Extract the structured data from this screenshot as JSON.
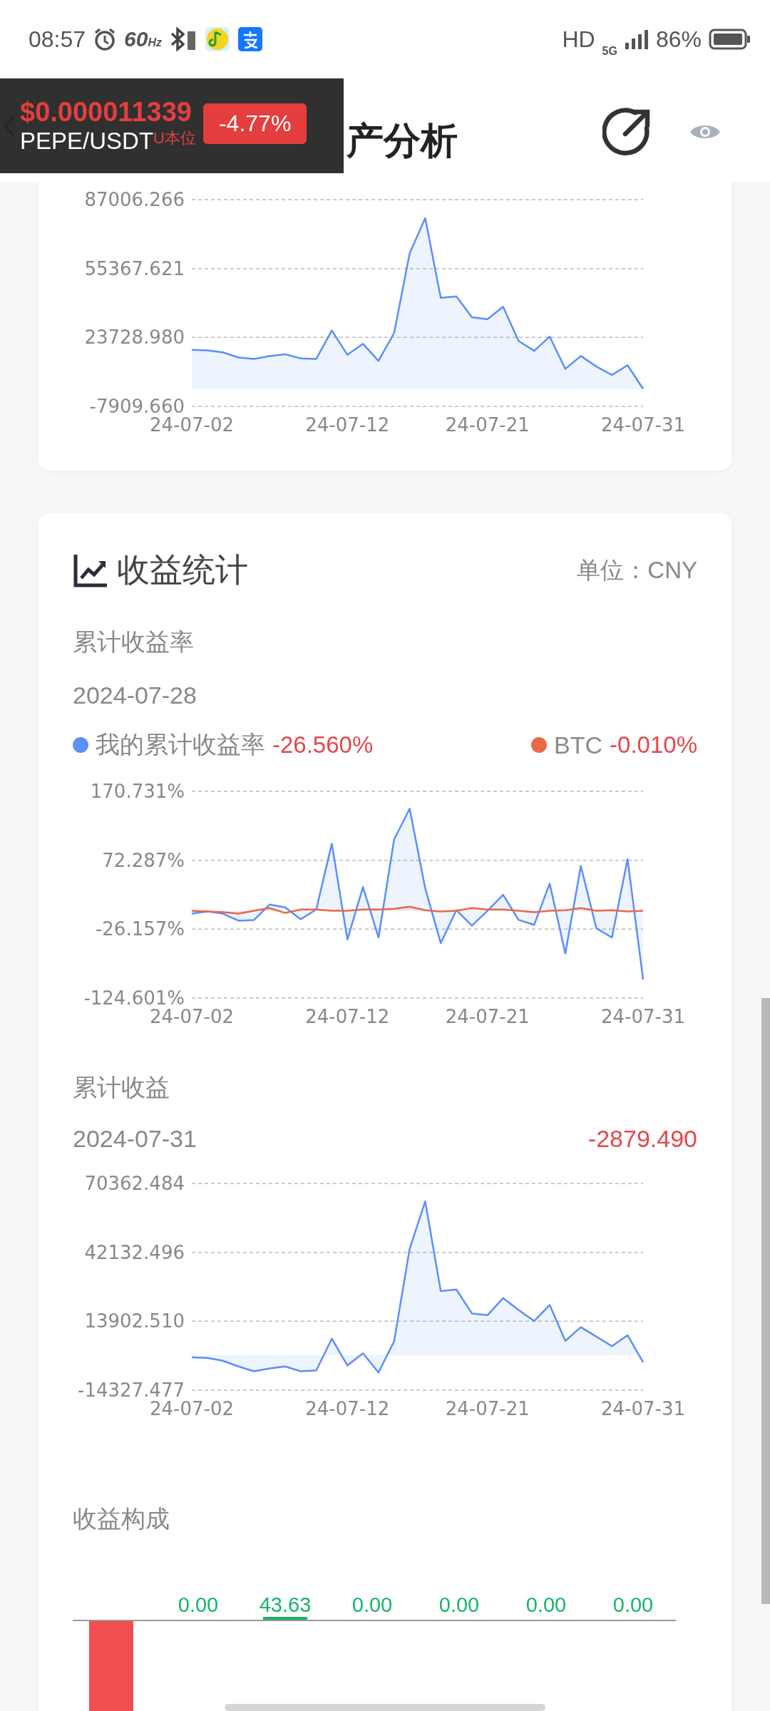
{
  "status_bar": {
    "time": "08:57",
    "refresh_rate": "60",
    "refresh_unit": "Hz",
    "network_hd": "HD",
    "network_type": "5G",
    "battery": "86%"
  },
  "ticker": {
    "price": "$0.000011339",
    "pair": "PEPE/USDT",
    "market": "U本位",
    "change": "-4.77%"
  },
  "header": {
    "title": "产分析"
  },
  "asset_chart": {
    "chart_data": {
      "type": "area",
      "categories": [
        "24-07-02",
        null,
        null,
        null,
        null,
        null,
        null,
        null,
        null,
        null,
        "24-07-12",
        null,
        null,
        null,
        null,
        null,
        null,
        null,
        null,
        "24-07-21",
        null,
        null,
        null,
        null,
        null,
        null,
        null,
        null,
        null,
        "24-07-31"
      ],
      "series": [
        {
          "color": "#5b8ff9",
          "values": [
            18000,
            17800,
            16900,
            14500,
            13900,
            15200,
            16000,
            14100,
            13900,
            26900,
            15800,
            20800,
            13000,
            25800,
            62400,
            78500,
            41900,
            42600,
            33000,
            32100,
            37800,
            22100,
            17600,
            24100,
            9300,
            15200,
            10400,
            6500,
            11000,
            100
          ]
        }
      ],
      "ylim": [
        -7909.66,
        87006.266
      ],
      "yticks": [
        {
          "value": 87006.266,
          "label": "87006.266"
        },
        {
          "value": 55367.621,
          "label": "55367.621"
        },
        {
          "value": 23728.98,
          "label": "23728.980"
        },
        {
          "value": -7909.66,
          "label": "-7909.660"
        }
      ]
    }
  },
  "profit_stats": {
    "title": "收益统计",
    "unit": "单位：CNY",
    "rate": {
      "title": "累计收益率",
      "date": "2024-07-28",
      "readings": [
        "-26.560%",
        "-0.010%"
      ],
      "chart_data": {
        "type": "area",
        "categories": [
          "24-07-02",
          null,
          null,
          null,
          null,
          null,
          null,
          null,
          null,
          null,
          "24-07-12",
          null,
          null,
          null,
          null,
          null,
          null,
          null,
          null,
          "24-07-21",
          null,
          null,
          null,
          null,
          null,
          null,
          null,
          null,
          null,
          "24-07-31"
        ],
        "series": [
          {
            "name": "我的累计收益率",
            "color": "#5b8ff9",
            "values": [
              -4,
              -1,
              -4,
              -14,
              -13,
              9,
              5,
              -12,
              2,
              96,
              -41,
              34,
              -38,
              102,
              146,
              32,
              -46,
              1,
              -21,
              0,
              23,
              -13,
              -20,
              39,
              -61,
              64,
              -25,
              -38,
              74,
              -98
            ]
          },
          {
            "name": "BTC",
            "color": "#e8684a",
            "values": [
              0,
              -1,
              -2,
              -4,
              0,
              4,
              -3,
              2,
              2,
              0,
              0,
              2,
              2,
              3,
              6,
              1,
              -1,
              0,
              4,
              2,
              2,
              0,
              -2,
              0,
              1,
              4,
              0,
              1,
              -1,
              0
            ]
          }
        ],
        "ylim": [
          -124.601,
          170.731
        ],
        "yticks": [
          {
            "value": 170.731,
            "label": "170.731%"
          },
          {
            "value": 72.287,
            "label": "72.287%"
          },
          {
            "value": -26.157,
            "label": "-26.157%"
          },
          {
            "value": -124.601,
            "label": "-124.601%"
          }
        ]
      }
    },
    "profit": {
      "title": "累计收益",
      "date": "2024-07-31",
      "reading": "-2879.490",
      "chart_data": {
        "type": "area",
        "categories": [
          "24-07-02",
          null,
          null,
          null,
          null,
          null,
          null,
          null,
          null,
          null,
          "24-07-12",
          null,
          null,
          null,
          null,
          null,
          null,
          null,
          null,
          "24-07-21",
          null,
          null,
          null,
          null,
          null,
          null,
          null,
          null,
          null,
          "24-07-31"
        ],
        "series": [
          {
            "color": "#5b8ff9",
            "values": [
              -900,
              -1100,
              -2300,
              -4600,
              -6600,
              -5400,
              -4600,
              -6600,
              -6200,
              6800,
              -4200,
              800,
              -7100,
              5700,
              43600,
              63000,
              26300,
              26900,
              17100,
              16400,
              23400,
              18500,
              14000,
              20600,
              5900,
              11500,
              7600,
              3700,
              8200,
              -2900
            ]
          }
        ],
        "ylim": [
          -14327.477,
          70362.484
        ],
        "yticks": [
          {
            "value": 70362.484,
            "label": "70362.484"
          },
          {
            "value": 42132.496,
            "label": "42132.496"
          },
          {
            "value": 13902.51,
            "label": "13902.510"
          },
          {
            "value": -14327.477,
            "label": "-14327.477"
          }
        ]
      }
    },
    "composition": {
      "title": "收益构成",
      "items": [
        {
          "kind": "loss"
        },
        {
          "kind": "zero",
          "label": "0.00"
        },
        {
          "kind": "gain",
          "label": "43.63"
        },
        {
          "kind": "zero",
          "label": "0.00"
        },
        {
          "kind": "zero",
          "label": "0.00"
        },
        {
          "kind": "zero",
          "label": "0.00"
        },
        {
          "kind": "zero",
          "label": "0.00"
        }
      ]
    }
  }
}
